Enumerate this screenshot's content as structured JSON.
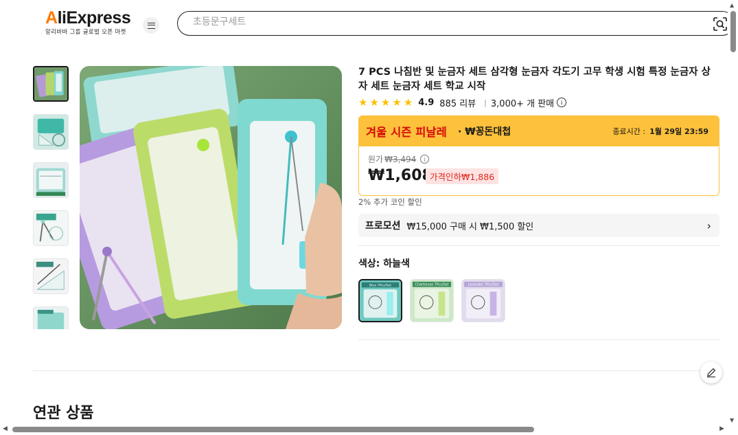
{
  "header": {
    "logo_text": "AliExpress",
    "logo_accent": "A",
    "logo_rest": "liExpress",
    "logo_tagline": "알리바바 그룹 글로벌 오픈 마켓",
    "search_placeholder": "초등문구세트",
    "menu_icon": "menu-icon",
    "search_icon": "camera-search-icon"
  },
  "product": {
    "title": "7 PCS 나침반 및 눈금자 세트 삼각형 눈금자 각도기 고무 학생 시험 특정 눈금자 상자 세트 눈금자 세트 학교 시작",
    "rating": "4.9",
    "reviews": "885 리뷰",
    "sold": "3,000+ 개 판매",
    "stars": 5
  },
  "sale": {
    "title": "겨울 시즌 피날레",
    "subtitle": "· ₩꽁돈대첩",
    "end_label": "종료시간 :",
    "end_time": "1월 29일 23:59",
    "original_label": "원가",
    "original_price": "₩3,494",
    "price": "₩1,608",
    "discount": "가격인하₩1,886",
    "coin_text": "2% 추가 코인 할인"
  },
  "promo": {
    "label": "프로모션",
    "text": "₩15,000 구매 시 ₩1,500 할인"
  },
  "color": {
    "label": "색상:",
    "selected": "하늘색",
    "swatches": [
      {
        "name": "Blue 7Pcs/Set"
      },
      {
        "name": "Chartreuse 7Pcs/Set"
      },
      {
        "name": "Lavender 7Pcs/Set"
      }
    ]
  },
  "related": {
    "title": "연관 상품"
  },
  "colors": {
    "accent": "#ff7a00",
    "sale_banner": "#fdc13b",
    "sale_red": "#d60a0a",
    "star": "#fdbf00"
  }
}
